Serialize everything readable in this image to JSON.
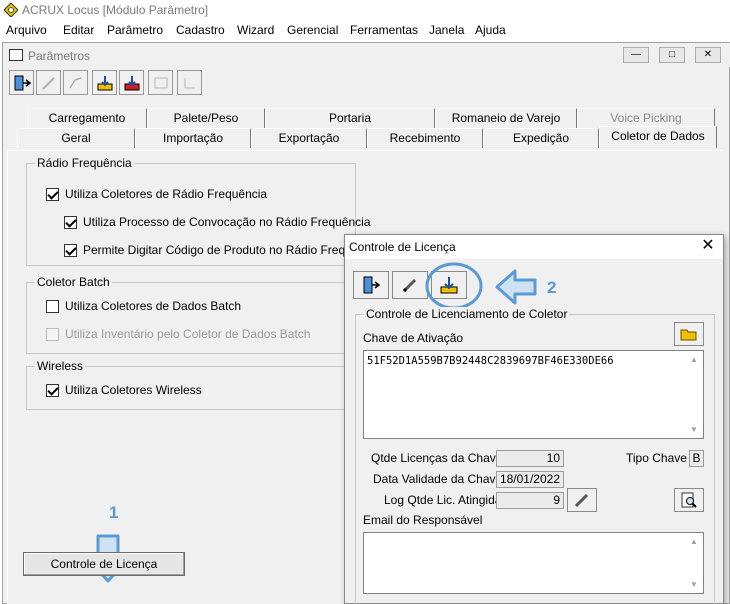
{
  "app": {
    "title": "ACRUX Locus [Módulo Parâmetro]",
    "menu": [
      "Arquivo",
      "Editar",
      "Parâmetro",
      "Cadastro",
      "Wizard",
      "Gerencial",
      "Ferramentas",
      "Janela",
      "Ajuda"
    ]
  },
  "child_window": {
    "title": "Parâmetros",
    "window_buttons": [
      "—",
      "□",
      "✕"
    ]
  },
  "tabs_row1": [
    "Carregamento",
    "Palete/Peso",
    "Portaria",
    "Romaneio de Varejo",
    "Voice Picking"
  ],
  "tabs_row2": [
    "Geral",
    "Importação",
    "Exportação",
    "Recebimento",
    "Expedição",
    "Coletor de Dados"
  ],
  "active_tab": "Coletor de Dados",
  "radio_group": {
    "title": "Rádio Frequência",
    "items": [
      {
        "label": "Utiliza Coletores de Rádio Frequência",
        "checked": true
      },
      {
        "label": "Utiliza Processo de Convocação no Rádio Frequência",
        "checked": true
      },
      {
        "label": "Permite Digitar Código de Produto no Rádio Frequência",
        "checked": true
      }
    ]
  },
  "batch_group": {
    "title": "Coletor Batch",
    "items": [
      {
        "label": "Utiliza Coletores de Dados Batch",
        "checked": false
      },
      {
        "label": "Utiliza Inventário pelo Coletor de Dados Batch",
        "checked": false,
        "disabled": true
      }
    ]
  },
  "wireless_group": {
    "title": "Wireless",
    "items": [
      {
        "label": "Utiliza Coletores Wireless",
        "checked": true
      }
    ]
  },
  "controle_button": "Controle de Licença",
  "annotations": {
    "step1": "1",
    "step2": "2",
    "accent": "#5b9bd5"
  },
  "dialog": {
    "title": "Controle de Licença",
    "close": "✕",
    "group_title": "Controle de Licenciamento de Coletor",
    "chave_label": "Chave de Ativação",
    "chave_value": "51F52D1A559B7B92448C2839697BF46E330DE66",
    "qtde_label": "Qtde Licenças da Chave",
    "qtde_value": "10",
    "tipo_label": "Tipo Chave",
    "tipo_value": "B",
    "validade_label": "Data Validade da Chave",
    "validade_value": "18/01/2022",
    "log_label": "Log Qtde Lic. Atingida",
    "log_value": "9",
    "email_label": "Email do Responsável"
  }
}
